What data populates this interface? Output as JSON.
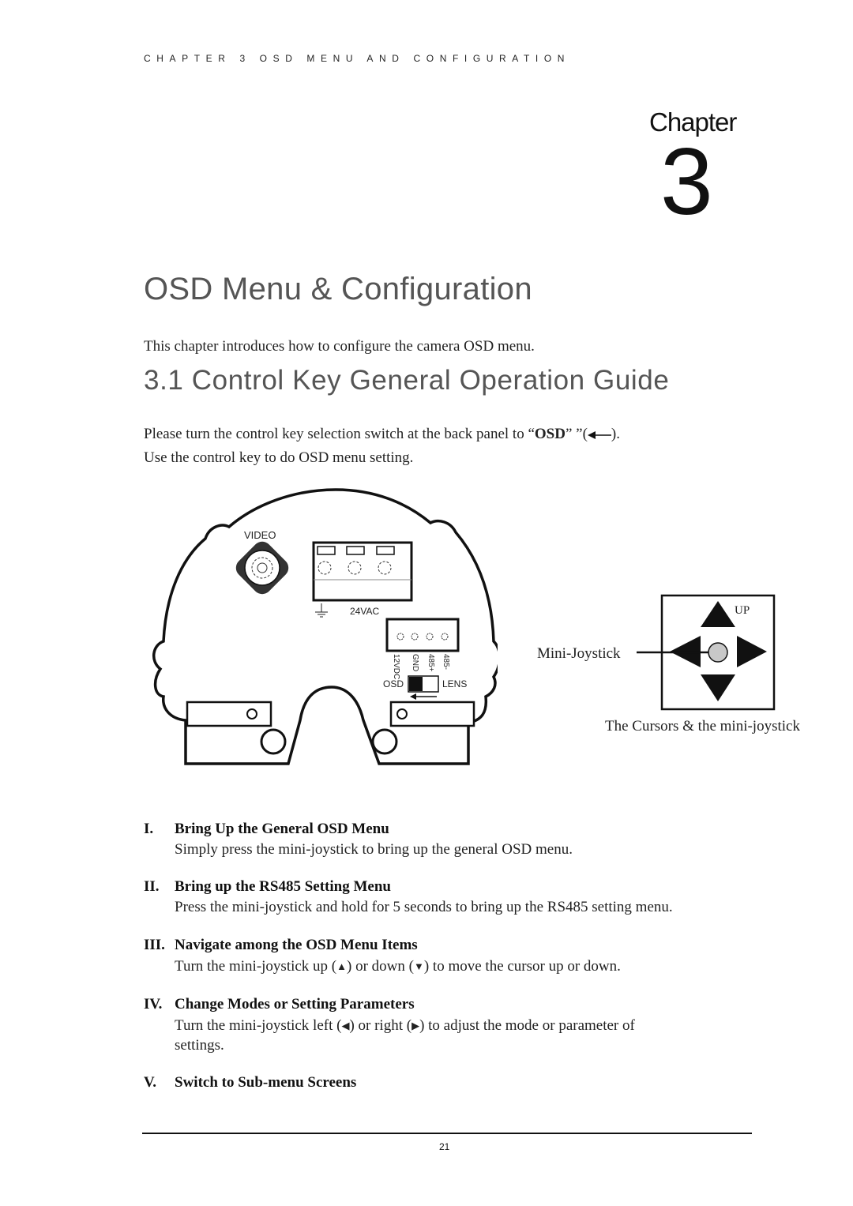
{
  "running_header": "CHAPTER 3 OSD MENU AND CONFIGURATION",
  "chapter": {
    "label": "Chapter",
    "number": "3"
  },
  "page_title": "OSD Menu & Configuration",
  "intro": "This chapter introduces how to configure the camera OSD menu.",
  "section": {
    "title": "3.1 Control Key General Operation Guide",
    "para1_pre": "Please turn the control key selection switch at the back panel to “",
    "para1_bold": "OSD",
    "para1_post": "” ”(",
    "para1_end": ").",
    "para2": "Use the control key to do OSD menu setting."
  },
  "figure": {
    "labels": {
      "video": "VIDEO",
      "power": "24VAC",
      "terminals": [
        "12VDC",
        "GND",
        "485+",
        "485-"
      ],
      "switch_left": "OSD",
      "switch_right": "LENS"
    },
    "joystick": {
      "up_label": "UP",
      "pointer_label": "Mini-Joystick",
      "caption": "The Cursors & the mini-joystick"
    }
  },
  "items": [
    {
      "num": "I.",
      "title": "Bring Up the General OSD Menu",
      "body": [
        "Simply press the mini-joystick to bring up the general OSD menu."
      ]
    },
    {
      "num": "II.",
      "title": "Bring up the RS485 Setting Menu",
      "body": [
        "Press the mini-joystick and hold for 5 seconds to bring up the RS485 setting menu."
      ]
    },
    {
      "num": "III.",
      "title": "Navigate among the OSD Menu Items",
      "body_parts": [
        "Turn the mini-joystick up (",
        "▲",
        ") or down (",
        "▼",
        ") to move the cursor up or down."
      ]
    },
    {
      "num": "IV.",
      "title": "Change Modes or Setting Parameters",
      "body_parts": [
        "Turn the mini-joystick left (",
        "◀",
        ") or right (",
        "▶",
        ") to adjust the mode or parameter of"
      ],
      "body_line2": "settings."
    },
    {
      "num": "V.",
      "title": "Switch to Sub-menu Screens"
    }
  ],
  "page_number": "21"
}
